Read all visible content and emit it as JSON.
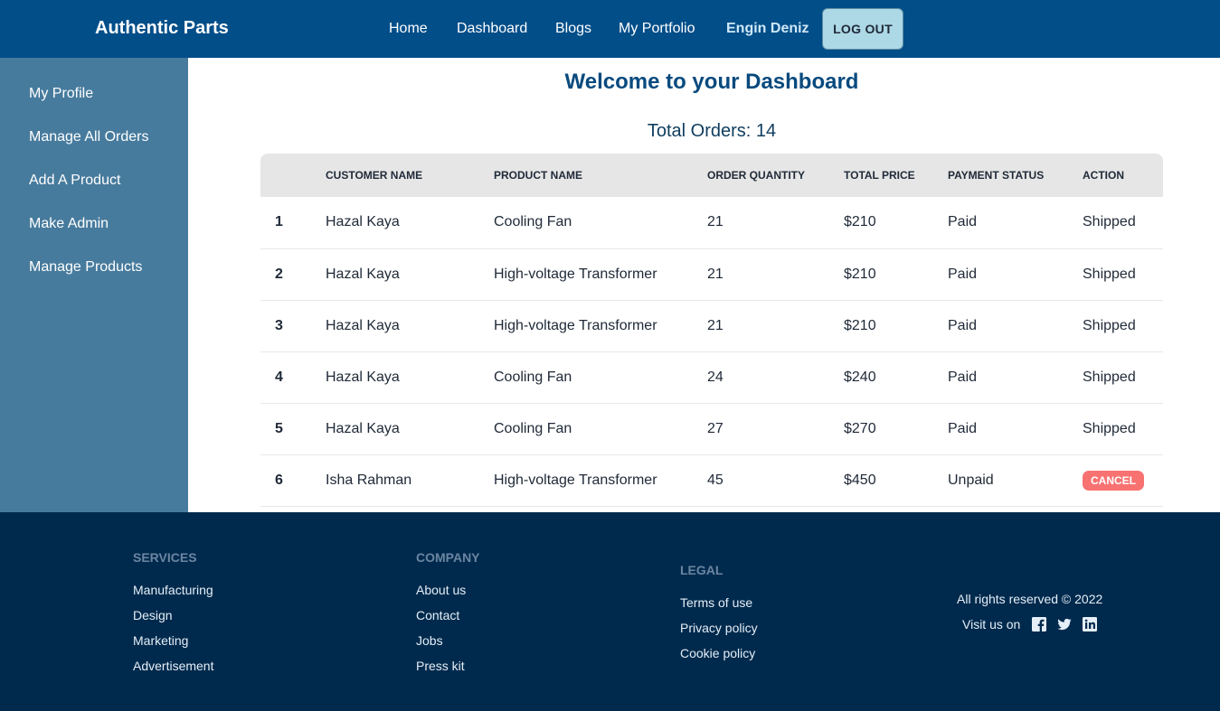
{
  "navbar": {
    "brand": "Authentic Parts",
    "links": [
      "Home",
      "Dashboard",
      "Blogs",
      "My Portfolio"
    ],
    "user": "Engin Deniz",
    "logout_label": "LOG OUT"
  },
  "sidebar": {
    "items": [
      "My Profile",
      "Manage All Orders",
      "Add A Product",
      "Make Admin",
      "Manage Products"
    ]
  },
  "main": {
    "title": "Welcome to your Dashboard",
    "total_orders": "Total Orders: 14",
    "table": {
      "headers": [
        "",
        "Customer Name",
        "Product Name",
        "Order Quantity",
        "Total Price",
        "Payment Status",
        "Action"
      ],
      "rows": [
        {
          "idx": "1",
          "customer": "Hazal Kaya",
          "product": "Cooling Fan",
          "qty": "21",
          "price": "$210",
          "payment": "Paid",
          "action": "Shipped"
        },
        {
          "idx": "2",
          "customer": "Hazal Kaya",
          "product": "High-voltage Transformer",
          "qty": "21",
          "price": "$210",
          "payment": "Paid",
          "action": "Shipped"
        },
        {
          "idx": "3",
          "customer": "Hazal Kaya",
          "product": "High-voltage Transformer",
          "qty": "21",
          "price": "$210",
          "payment": "Paid",
          "action": "Shipped"
        },
        {
          "idx": "4",
          "customer": "Hazal Kaya",
          "product": "Cooling Fan",
          "qty": "24",
          "price": "$240",
          "payment": "Paid",
          "action": "Shipped"
        },
        {
          "idx": "5",
          "customer": "Hazal Kaya",
          "product": "Cooling Fan",
          "qty": "27",
          "price": "$270",
          "payment": "Paid",
          "action": "Shipped"
        },
        {
          "idx": "6",
          "customer": "Isha Rahman",
          "product": "High-voltage Transformer",
          "qty": "45",
          "price": "$450",
          "payment": "Unpaid",
          "action": "cancel"
        }
      ]
    }
  },
  "footer": {
    "services": {
      "title": "Services",
      "links": [
        "Manufacturing",
        "Design",
        "Marketing",
        "Advertisement"
      ]
    },
    "company": {
      "title": "Company",
      "links": [
        "About us",
        "Contact",
        "Jobs",
        "Press kit"
      ]
    },
    "legal": {
      "title": "Legal",
      "links": [
        "Terms of use",
        "Privacy policy",
        "Cookie policy"
      ]
    },
    "copyright": "All rights reserved © 2022",
    "visit_us": "Visit us on",
    "social": [
      "facebook-icon",
      "twitter-icon",
      "linkedin-icon"
    ]
  },
  "colors": {
    "navbar": "#024e89",
    "sidebar": "#477b9d",
    "footer": "#002a4d",
    "paid": "#2f7a48",
    "unpaid": "#8b2a1f",
    "cancel": "#f87272",
    "logout": "#add8e6"
  }
}
